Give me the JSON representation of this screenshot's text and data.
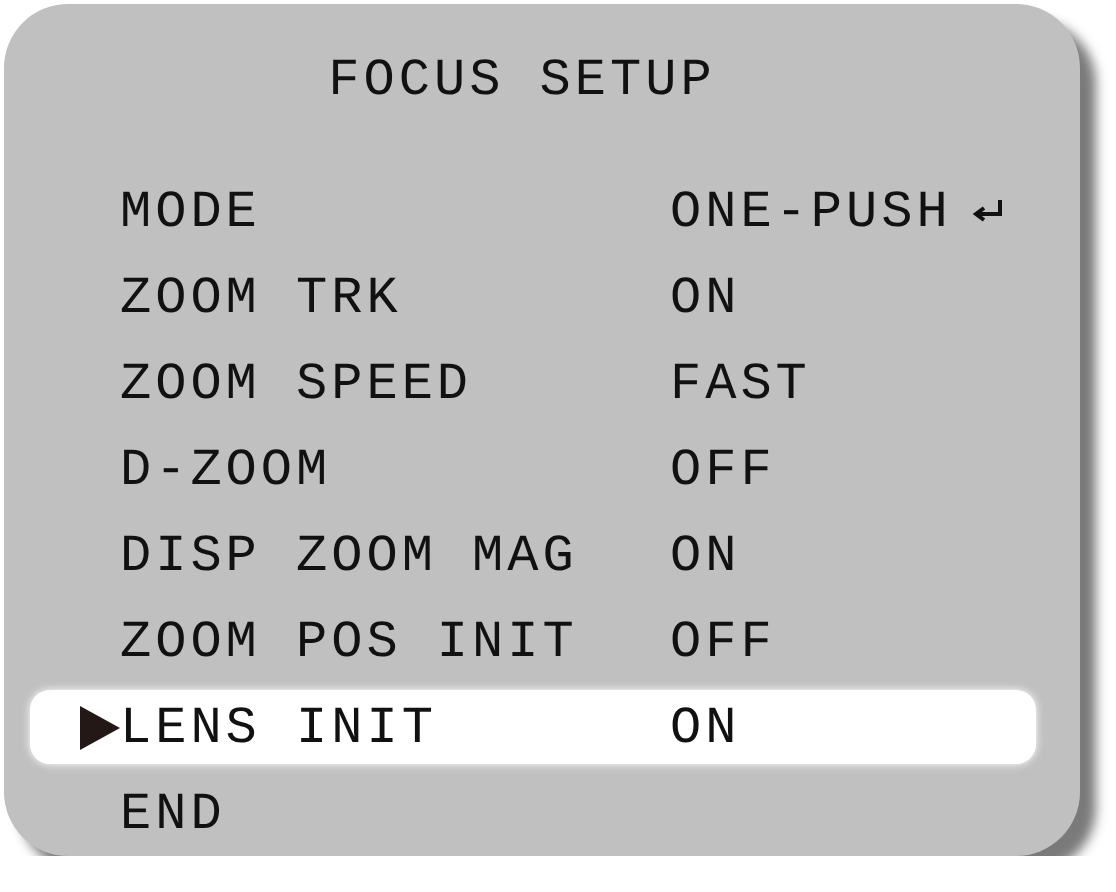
{
  "title": "FOCUS SETUP",
  "items": [
    {
      "label": "MODE",
      "value": "ONE-PUSH",
      "submenu": true,
      "selected": false
    },
    {
      "label": "ZOOM TRK",
      "value": "ON",
      "submenu": false,
      "selected": false
    },
    {
      "label": "ZOOM SPEED",
      "value": "FAST",
      "submenu": false,
      "selected": false
    },
    {
      "label": "D-ZOOM",
      "value": "OFF",
      "submenu": false,
      "selected": false
    },
    {
      "label": "DISP ZOOM MAG",
      "value": "ON",
      "submenu": false,
      "selected": false
    },
    {
      "label": "ZOOM POS INIT",
      "value": "OFF",
      "submenu": false,
      "selected": false
    },
    {
      "label": "LENS INIT",
      "value": "ON",
      "submenu": false,
      "selected": true
    },
    {
      "label": "END",
      "submenu": false,
      "selected": false
    }
  ]
}
